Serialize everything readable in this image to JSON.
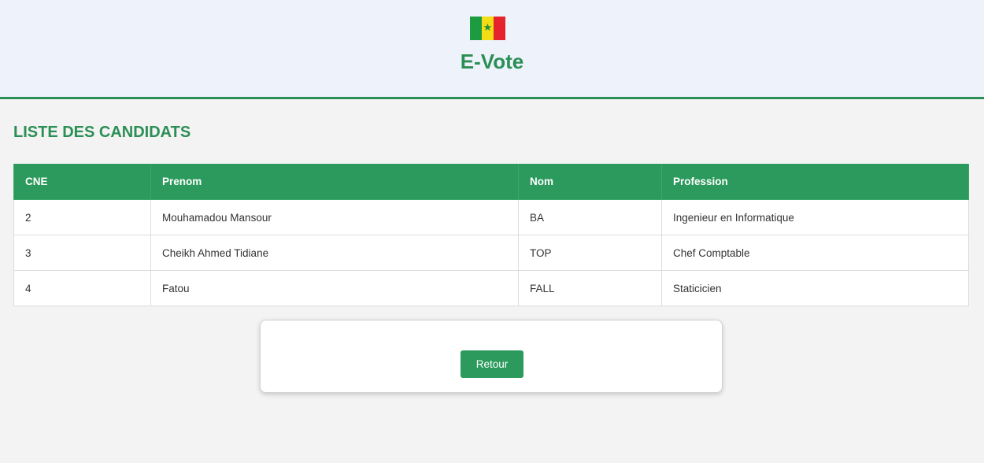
{
  "header": {
    "title": "E-Vote",
    "flag_colors": [
      "#1d9b40",
      "#f4dc17",
      "#e5232c"
    ],
    "flag_star": "★"
  },
  "section": {
    "title": "LISTE DES CANDIDATS"
  },
  "table": {
    "headers": [
      "CNE",
      "Prenom",
      "Nom",
      "Profession"
    ],
    "rows": [
      [
        "2",
        "Mouhamadou Mansour",
        "BA",
        "Ingenieur en Informatique"
      ],
      [
        "3",
        "Cheikh Ahmed Tidiane",
        "TOP",
        "Chef Comptable"
      ],
      [
        "4",
        "Fatou",
        "FALL",
        "Staticicien"
      ]
    ]
  },
  "actions": {
    "back_label": "Retour"
  },
  "colors": {
    "accent": "#2b9a5c",
    "header_bg": "#edf2fb",
    "page_bg": "#f3f3f3"
  }
}
